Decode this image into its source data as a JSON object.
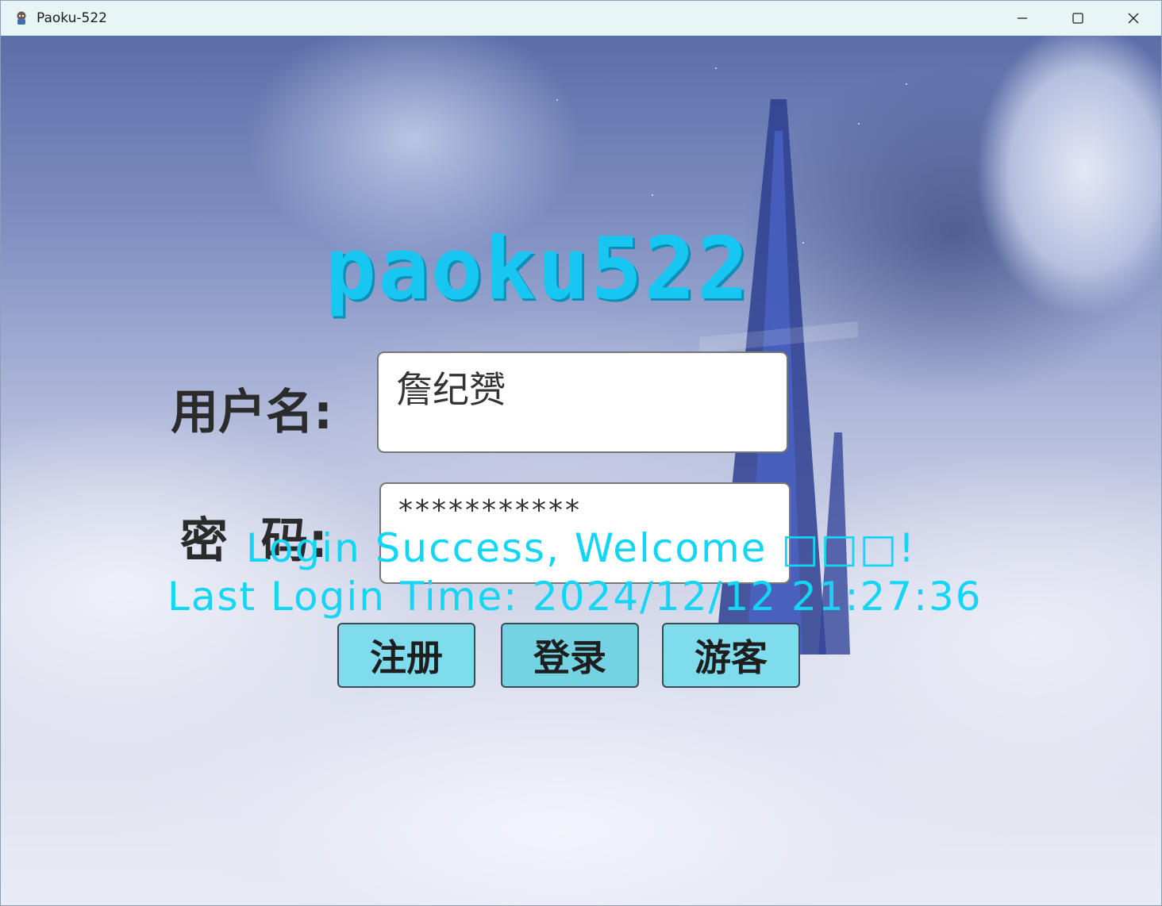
{
  "window": {
    "title": "Paoku-522",
    "controls": {
      "minimize": "—",
      "maximize": "☐",
      "close": "✕"
    }
  },
  "logo": {
    "text": "paoku522",
    "color": "#18c6f2"
  },
  "form": {
    "username_label": "用户名:",
    "username_value": "詹纪赟",
    "password_label": "密  码:",
    "password_value": "***********"
  },
  "buttons": {
    "register": "注册",
    "login": "登录",
    "guest": "游客"
  },
  "status": {
    "line1": "Login Success, Welcome □□□!",
    "line2": "Last Login Time: 2024/12/12 21:27:36",
    "color": "#12d6f4"
  },
  "icons": {
    "app": "app-icon",
    "minimize": "minimize-icon",
    "maximize": "maximize-icon",
    "close": "close-icon"
  }
}
